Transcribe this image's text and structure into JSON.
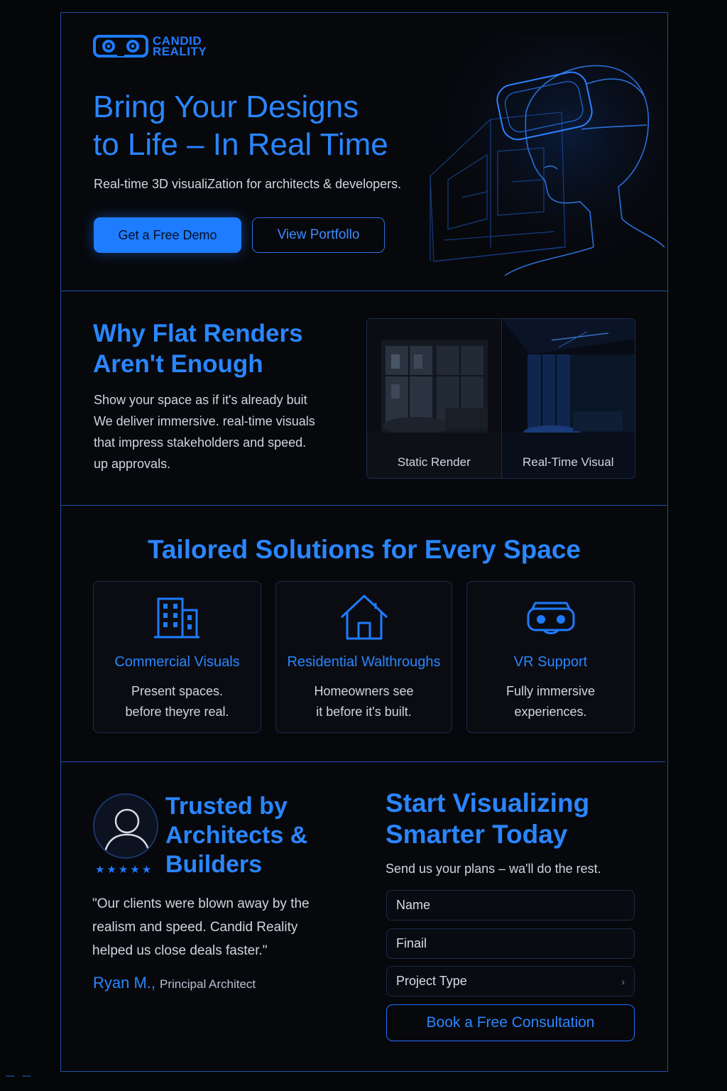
{
  "brand": {
    "name_line1": "CANDID",
    "name_line2": "REALITY"
  },
  "hero": {
    "title_line1": "Bring Your Designs",
    "title_line2": "to Life – In Real Time",
    "subtitle": "Real-time 3D visualiZation for architects & developers.",
    "primary_cta": "Get a Free Demo",
    "secondary_cta": "View Portfollo"
  },
  "why": {
    "title_line1": "Why Flat Renders",
    "title_line2": "Aren't Enough",
    "body_lines": [
      "Show your space as if it's already buit",
      "We deliver immersive. real-time visuals",
      "that impress stakeholders and speed.",
      "up approvals."
    ],
    "compare_left_label": "Static Render",
    "compare_right_label": "Real-Time Visual"
  },
  "solutions": {
    "title": "Tailored Solutions for Every Space",
    "cards": [
      {
        "icon": "building-icon",
        "title": "Commercial Visuals",
        "desc_line1": "Present spaces.",
        "desc_line2": "before theyre real."
      },
      {
        "icon": "house-icon",
        "title": "Residential Walthroughs",
        "desc_line1": "Homeowners see",
        "desc_line2": "it before it's built."
      },
      {
        "icon": "vr-headset-icon",
        "title": "VR Support",
        "desc_line1": "Fully immersive",
        "desc_line2": "experiences."
      }
    ]
  },
  "testimonial": {
    "title_line1": "Trusted by",
    "title_line2": "Architects &",
    "title_line3": "Builders",
    "stars": "★★★★★",
    "rating": 5,
    "quote_lines": [
      "\"Our clients were blown away by the",
      "realism and speed. Candid Reality",
      "helped us close deals faster.\""
    ],
    "author_name": "Ryan M.,",
    "author_role": "Principal Architect"
  },
  "cta": {
    "title_line1": "Start Visualizing",
    "title_line2": "Smarter Today",
    "subtitle": "Send us your plans – wa'll do the rest.",
    "name_placeholder": "Name",
    "email_placeholder": "Finail",
    "project_type_label": "Project Type",
    "chevron": "›",
    "submit_label": "Book a Free Consultation"
  },
  "colors": {
    "accent": "#1e7bff",
    "accent_text": "#2a86ff",
    "background": "#050608",
    "border": "#1f4fa8"
  }
}
